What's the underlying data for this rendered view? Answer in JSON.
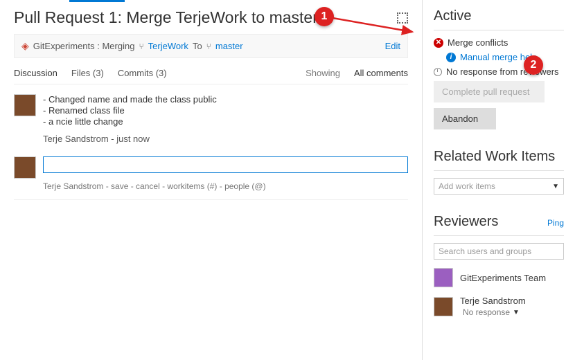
{
  "title": "Pull Request 1: Merge TerjeWork to master",
  "branchBar": {
    "repo": "GitExperiments : Merging",
    "source": "TerjeWork",
    "to": "To",
    "target": "master",
    "edit": "Edit"
  },
  "tabs": {
    "discussion": "Discussion",
    "files": "Files (3)",
    "commits": "Commits (3)",
    "showing": "Showing",
    "filter": "All comments"
  },
  "comment": {
    "lines": [
      "- Changed name and made the class public",
      "- Renamed class file",
      "- a ncie little change"
    ],
    "author": "Terje Sandstrom",
    "timesep": " - ",
    "time": "just now"
  },
  "compose": {
    "hint": "Terje Sandstrom - save - cancel - workitems (#) - people (@)"
  },
  "sidebar": {
    "activeHeader": "Active",
    "mergeConflicts": "Merge conflicts",
    "manualHelp": "Manual merge help",
    "noResponse": "No response from reviewers",
    "completeBtn": "Complete pull request",
    "abandonBtn": "Abandon",
    "relatedHeader": "Related Work Items",
    "addWorkItems": "Add work items",
    "reviewersHeader": "Reviewers",
    "ping": "Ping",
    "searchPlaceholder": "Search users and groups",
    "reviewer1": "GitExperiments Team",
    "reviewer2": "Terje Sandstrom",
    "reviewer2Status": "No response"
  },
  "callouts": {
    "c1": "1",
    "c2": "2"
  }
}
